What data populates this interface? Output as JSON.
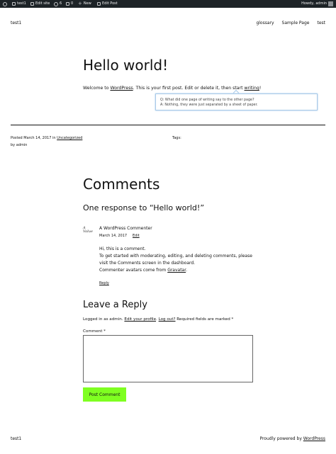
{
  "adminbar": {
    "site_name": "test1",
    "edit_site": "Edit site",
    "updates_count": "6",
    "comments_count": "0",
    "new_label": "New",
    "edit_post": "Edit Post",
    "howdy": "Howdy, admin"
  },
  "header": {
    "site_title": "test1",
    "nav": [
      "glossary",
      "Sample Page",
      "test"
    ]
  },
  "post": {
    "title": "Hello world!",
    "text_prefix": "Welcome to ",
    "text_link_wordpress": "WordPress",
    "text_middle": ". This is your first post. Edit or delete it, then start ",
    "text_link_writing": "writing",
    "text_suffix": "!",
    "tooltip_q": "Q: What did one page of writing say to the other page?",
    "tooltip_a": "A: Nothing, they were just separated by a sheet of paper.",
    "meta_posted": "Posted March 14, 2017 in ",
    "meta_category": "Uncategorized",
    "meta_author": "by admin",
    "tags_label": "Tags:"
  },
  "comments": {
    "title": "Comments",
    "response_title": "One response to “Hello world!”",
    "avatar_text": "A\nValue",
    "author": "A WordPress Commenter",
    "date": "March 14, 2017",
    "edit_label": "Edit",
    "body_line1": "Hi, this is a comment.",
    "body_line2": "To get started with moderating, editing, and deleting comments, please",
    "body_line3": "visit the Comments screen in the dashboard.",
    "body_line4_prefix": "Commenter avatars come from ",
    "body_line4_link": "Gravatar",
    "body_line4_suffix": ".",
    "reply_label": "Reply"
  },
  "reply_form": {
    "title": "Leave a Reply",
    "logged_prefix": "Logged in as admin. ",
    "edit_profile": "Edit your profile",
    "logged_sep": ". ",
    "logout": "Log out?",
    "logged_suffix": " Required fields are marked *",
    "comment_label": "Comment *",
    "submit_label": "Post Comment",
    "submit_color": "#7fff21"
  },
  "footer": {
    "site_title": "test1",
    "powered_prefix": "Proudly powered by ",
    "powered_link": "WordPress"
  }
}
